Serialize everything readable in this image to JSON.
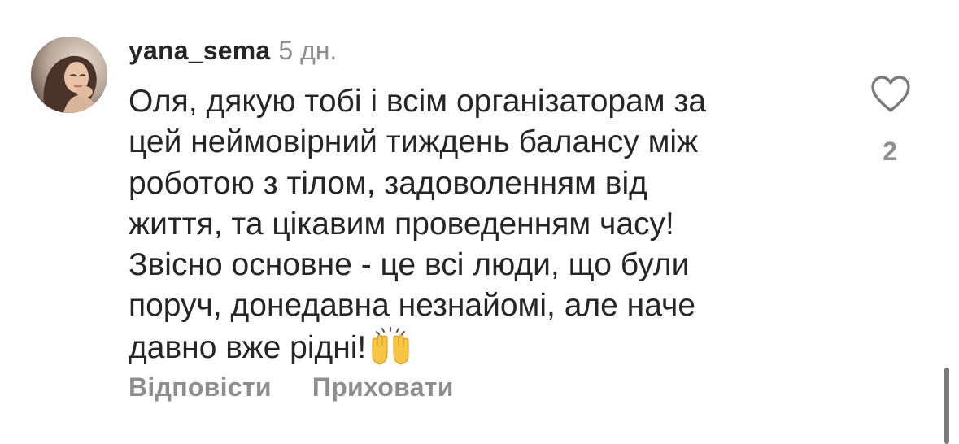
{
  "comment": {
    "username": "yana_sema",
    "timestamp": "5 дн.",
    "lines": [
      "Оля, дякую тобі і всім організаторам за",
      "цей неймовірний тиждень балансу між",
      "роботою з тілом, задоволенням від",
      "життя, та цікавим проведенням часу!",
      "Звісно основне - це всі люди, що були",
      "поруч, донедавна незнайомі, але наче",
      "давно вже рідні!"
    ],
    "emoji": "raising-hands-emoji",
    "like_count": "2",
    "like_icon": "heart-outline-icon"
  },
  "actions": {
    "reply_label": "Відповісти",
    "hide_label": "Приховати"
  },
  "colors": {
    "text": "#262626",
    "secondary": "#8e8e8e",
    "background": "#ffffff"
  }
}
